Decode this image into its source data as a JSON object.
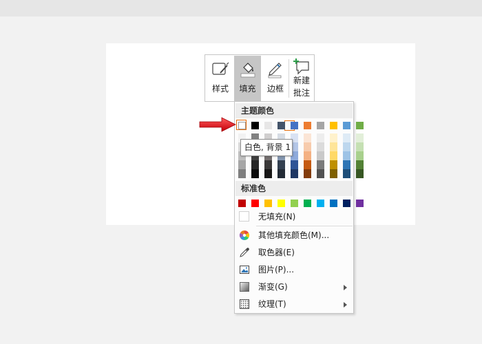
{
  "toolbar": {
    "style_label": "样式",
    "fill_label": "填充",
    "border_label": "边框",
    "new_comment_line1": "新建",
    "new_comment_line2": "批注"
  },
  "menu": {
    "theme_colors_header": "主题颜色",
    "theme_top_row": [
      "#ffffff",
      "#000000",
      "#e7e6e6",
      "#44546a",
      "#4472c4",
      "#ed7d31",
      "#a5a5a5",
      "#ffc000",
      "#5b9bd5",
      "#70ad47"
    ],
    "theme_shades": [
      [
        "#f2f2f2",
        "#808080",
        "#d0cece",
        "#d6dce4",
        "#d9e2f3",
        "#fbe5d5",
        "#ededed",
        "#fff2cc",
        "#deebf6",
        "#e2efd9"
      ],
      [
        "#d9d9d9",
        "#595959",
        "#aeabab",
        "#adb9ca",
        "#b4c6e7",
        "#f7cbac",
        "#dbdbdb",
        "#fee599",
        "#bdd7ee",
        "#c5e0b3"
      ],
      [
        "#bfbfbf",
        "#404040",
        "#757070",
        "#8496b0",
        "#8eaadb",
        "#f4b183",
        "#c9c9c9",
        "#ffd966",
        "#9dc3e6",
        "#a8d08d"
      ],
      [
        "#a6a6a6",
        "#262626",
        "#3a3838",
        "#323f4f",
        "#2f5496",
        "#c55a11",
        "#7b7b7b",
        "#bf9000",
        "#2e75b5",
        "#538135"
      ],
      [
        "#7f7f7f",
        "#0d0d0d",
        "#171616",
        "#222a35",
        "#1f3864",
        "#833c0b",
        "#525252",
        "#7f6000",
        "#1e4e79",
        "#375623"
      ]
    ],
    "standard_colors_header": "标准色",
    "standard_colors": [
      "#c00000",
      "#ff0000",
      "#ffc000",
      "#ffff00",
      "#92d050",
      "#00b050",
      "#00b0f0",
      "#0070c0",
      "#002060",
      "#7030a0"
    ],
    "no_fill": "无填充(N)",
    "more_fill_colors": "其他填充颜色(M)...",
    "eyedropper": "取色器(E)",
    "picture": "图片(P)...",
    "gradient": "渐变(G)",
    "texture": "纹理(T)",
    "tooltip": "白色, 背景 1"
  },
  "colors": {
    "annotation_arrow": "#e0161b",
    "selected_swatch_border": "#e46c0a"
  },
  "icons": [
    "style-icon",
    "fill-bucket-icon",
    "border-pen-icon",
    "new-comment-icon",
    "color-wheel-icon",
    "eyedropper-icon",
    "picture-icon",
    "gradient-icon",
    "texture-icon",
    "submenu-arrow-icon"
  ]
}
